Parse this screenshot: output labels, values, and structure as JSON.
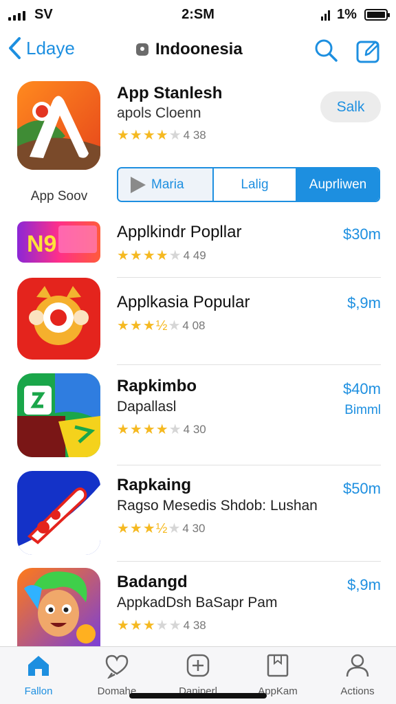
{
  "status_bar": {
    "carrier": "SV",
    "time": "2:SM",
    "battery": "1%"
  },
  "nav": {
    "back_label": "Ldaye",
    "title": "Indoonesia"
  },
  "featured": {
    "title": "App Stanlesh",
    "subtitle": "apols Cloenn",
    "rating_stars": 4,
    "rating_text": "4 38",
    "action_label": "Salk",
    "caption": "App Soov",
    "segments": [
      "Maria",
      "Lalig",
      "Auprliwen"
    ]
  },
  "apps": [
    {
      "title": "Applkindr Popllar",
      "subtitle": "",
      "rating_stars": 4,
      "rating_text": "4 49",
      "price": "$30m",
      "price2": ""
    },
    {
      "title": "Applkasia Popular",
      "subtitle": "",
      "rating_stars": 3.5,
      "rating_text": "4 08",
      "price": "$,9m",
      "price2": ""
    },
    {
      "title": "Rapkimbo",
      "subtitle": "Dapallasl",
      "rating_stars": 4,
      "rating_text": "4 30",
      "price": "$40m",
      "price2": "Bimml"
    },
    {
      "title": "Rapkaing",
      "subtitle": "Ragso Mesedis Shdob: Lushan",
      "rating_stars": 3.5,
      "rating_text": "4 30",
      "price": "$50m",
      "price2": ""
    },
    {
      "title": "Badangd",
      "subtitle": "AppkadDsh BaSapr Pam",
      "rating_stars": 3,
      "rating_text": "4 38",
      "price": "$,9m",
      "price2": ""
    }
  ],
  "tabs": [
    {
      "label": "Fallon",
      "icon": "home-icon",
      "active": true
    },
    {
      "label": "Domahe",
      "icon": "heart-chat-icon",
      "active": false
    },
    {
      "label": "Daniperl",
      "icon": "plus-square-icon",
      "active": false
    },
    {
      "label": "AppKam",
      "icon": "bookmark-icon",
      "active": false
    },
    {
      "label": "Actions",
      "icon": "person-icon",
      "active": false
    }
  ],
  "colors": {
    "accent": "#1d8fe0",
    "star": "#f5b921"
  }
}
